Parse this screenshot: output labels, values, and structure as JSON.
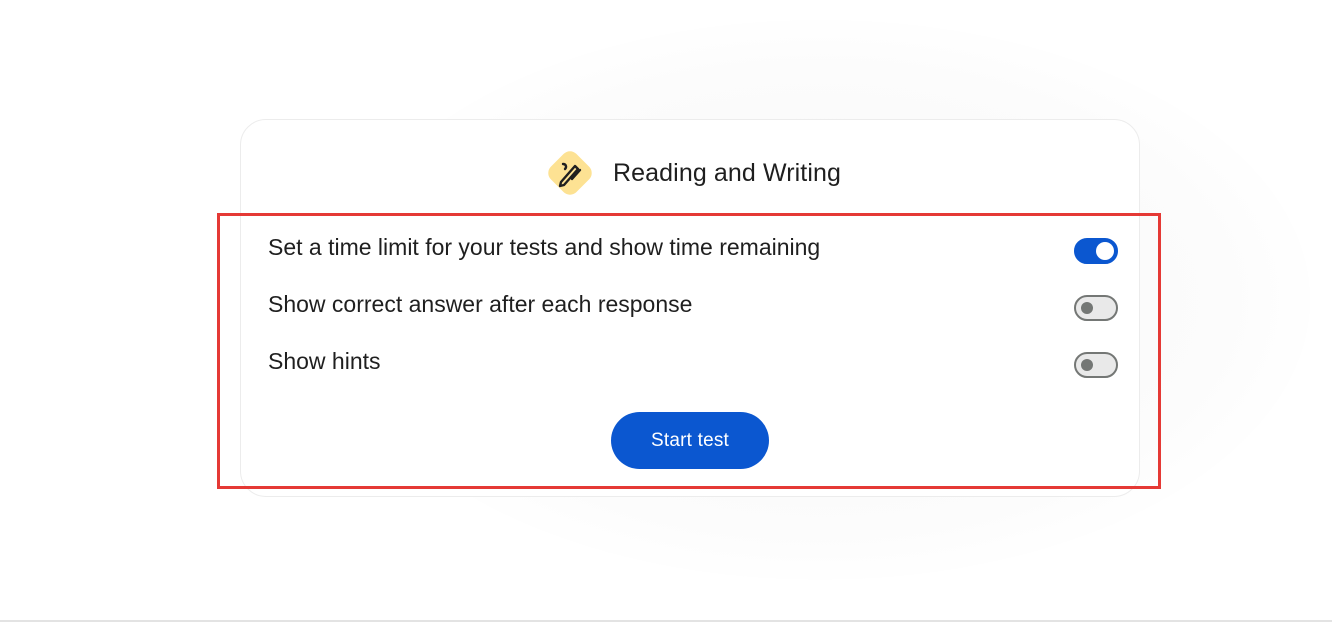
{
  "card": {
    "title": "Reading and Writing",
    "icon": "pencil-pen-icon",
    "icon_background": "#fde293"
  },
  "settings": [
    {
      "label": "Set a time limit for your tests and show time remaining",
      "enabled": true
    },
    {
      "label": "Show correct answer after each response",
      "enabled": false
    },
    {
      "label": "Show hints",
      "enabled": false
    }
  ],
  "start_button": {
    "label": "Start test"
  },
  "colors": {
    "accent": "#0b57d0",
    "highlight_outline": "#e53935",
    "toggle_off_outline": "#747775"
  }
}
